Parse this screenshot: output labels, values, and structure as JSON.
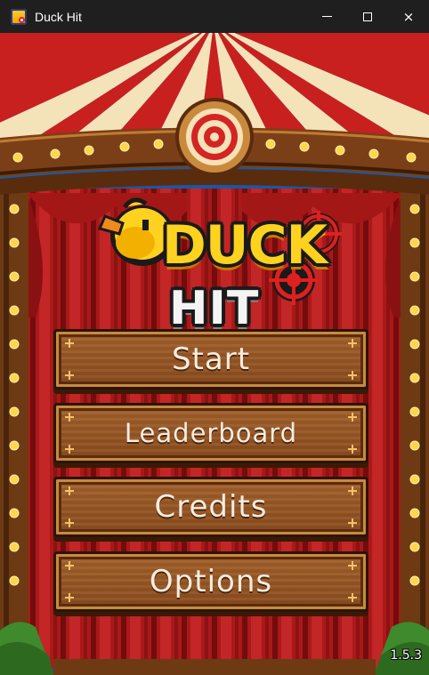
{
  "window": {
    "title": "Duck Hit",
    "controls": {
      "minimize": "minimize",
      "maximize": "maximize",
      "close": "×"
    }
  },
  "logo": {
    "line1": "DUCK",
    "line2": "HIT"
  },
  "menu": {
    "start": "Start",
    "leaderboard": "Leaderboard",
    "credits": "Credits",
    "options": "Options"
  },
  "version": "1.5.3",
  "icons": {
    "app": "duck-hit-app-icon",
    "target": "bullseye-target-icon",
    "crosshair": "crosshair-icon",
    "duck": "duck-head-icon"
  },
  "colors": {
    "sky": "#1858a8",
    "curtain_red": "#c81f1f",
    "stripe_cream": "#f4e2b8",
    "wood": "#8a4c1e",
    "bulb": "#ffd54a",
    "duck_yellow": "#ffd21f"
  }
}
